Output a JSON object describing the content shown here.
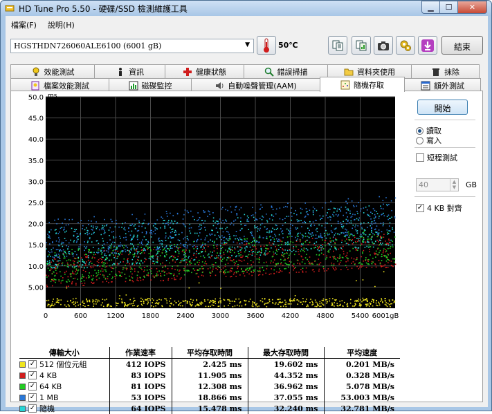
{
  "window": {
    "title": "HD Tune Pro 5.50 - 硬碟/SSD 檢測維護工具"
  },
  "menu": [
    "檔案(F)",
    "說明(H)"
  ],
  "toolbar": {
    "drive": "HGSTHDN726060ALE6100 (6001 gB)",
    "temperature": "50℃",
    "exit_label": "結束"
  },
  "tabs_row1": [
    "效能測試",
    "資訊",
    "健康狀態",
    "錯誤掃描",
    "資料夾使用",
    "抹除"
  ],
  "tabs_row2": [
    "檔案效能測試",
    "磁碟監控",
    "自動噪聲管理(AAM)",
    "隨機存取",
    "額外測試"
  ],
  "side": {
    "start_label": "開始",
    "read_label": "讀取",
    "write_label": "寫入",
    "selected_mode": "讀取",
    "short_test_label": "短程測試",
    "short_test_checked": false,
    "gb_value": "40",
    "gb_unit": "GB",
    "align_label": "4 KB 對齊",
    "align_checked": true
  },
  "colors": {
    "s512": "#f0e61e",
    "s4k": "#d21e1e",
    "s64k": "#22cc22",
    "s1m": "#2a78d8",
    "srand": "#26d6d6"
  },
  "table": {
    "headers": [
      "傳輸大小",
      "作業速率",
      "平均存取時間",
      "最大存取時間",
      "平均速度"
    ],
    "rows": [
      {
        "label": "512 個位元組",
        "color": "#f0e61e",
        "checked": true,
        "iops": "412 IOPS",
        "avg": "2.425 ms",
        "max": "19.602 ms",
        "speed": "0.201 MB/s"
      },
      {
        "label": "4 KB",
        "color": "#d21e1e",
        "checked": true,
        "iops": "83 IOPS",
        "avg": "11.905 ms",
        "max": "44.352 ms",
        "speed": "0.328 MB/s"
      },
      {
        "label": "64 KB",
        "color": "#22cc22",
        "checked": true,
        "iops": "81 IOPS",
        "avg": "12.308 ms",
        "max": "36.962 ms",
        "speed": "5.078 MB/s"
      },
      {
        "label": "1 MB",
        "color": "#2a78d8",
        "checked": true,
        "iops": "53 IOPS",
        "avg": "18.866 ms",
        "max": "37.055 ms",
        "speed": "53.003 MB/s"
      },
      {
        "label": "隨機",
        "color": "#26d6d6",
        "checked": true,
        "iops": "64 IOPS",
        "avg": "15.478 ms",
        "max": "32.240 ms",
        "speed": "32.781 MB/s"
      }
    ]
  },
  "chart_data": {
    "type": "scatter",
    "ylabel": "ms",
    "ylim": [
      0,
      50
    ],
    "xlim": [
      0,
      6001
    ],
    "x_unit": "gB",
    "y_ticks": [
      "50.0",
      "45.0",
      "40.0",
      "35.0",
      "30.0",
      "25.0",
      "20.0",
      "15.0",
      "10.0",
      "5.00"
    ],
    "x_ticks": [
      "0",
      "600",
      "1200",
      "1800",
      "2400",
      "3000",
      "3600",
      "4200",
      "4800",
      "5400",
      "6001gB"
    ],
    "grid": true,
    "series": [
      {
        "name": "512 個位元組",
        "color": "#f0e61e",
        "y_band": [
          0.5,
          2.5
        ],
        "slope": 0.0,
        "spread": 1.5,
        "density": 500
      },
      {
        "name": "4 KB",
        "color": "#d21e1e",
        "y_band": [
          5,
          13
        ],
        "slope": 0.0009,
        "spread": 8,
        "density": 650
      },
      {
        "name": "64 KB",
        "color": "#22cc22",
        "y_band": [
          6,
          14
        ],
        "slope": 0.0009,
        "spread": 8,
        "density": 650
      },
      {
        "name": "1 MB",
        "color": "#2a78d8",
        "y_band": [
          12,
          20
        ],
        "slope": 0.0011,
        "spread": 9,
        "density": 650
      },
      {
        "name": "隨機",
        "color": "#26d6d6",
        "y_band": [
          9,
          18
        ],
        "slope": 0.0011,
        "spread": 10,
        "density": 650
      }
    ]
  }
}
